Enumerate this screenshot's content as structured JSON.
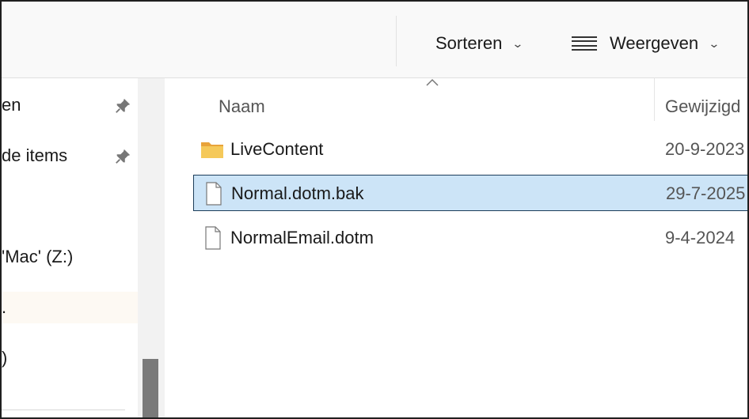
{
  "toolbar": {
    "sort_label": "Sorteren",
    "view_label": "Weergeven",
    "sort_icon": "chevron-down-icon",
    "view_icon": "list-view-icon"
  },
  "nav": {
    "items": [
      {
        "label": "en",
        "pinned": true
      },
      {
        "label": "de items",
        "pinned": true
      },
      {
        "label": "'Mac' (Z:)",
        "pinned": false
      },
      {
        "label": ".",
        "pinned": false
      },
      {
        "label": ")",
        "pinned": false
      }
    ]
  },
  "columns": {
    "name": "Naam",
    "modified": "Gewijzigd"
  },
  "files": [
    {
      "name": "LiveContent",
      "date": "20-9-2023",
      "type": "folder",
      "selected": false
    },
    {
      "name": "Normal.dotm.bak",
      "date": "29-7-2025",
      "type": "file",
      "selected": true
    },
    {
      "name": "NormalEmail.dotm",
      "date": "9-4-2024",
      "type": "file",
      "selected": false
    }
  ],
  "colors": {
    "selection": "#cce4f7",
    "folder": "#f2c14e"
  }
}
